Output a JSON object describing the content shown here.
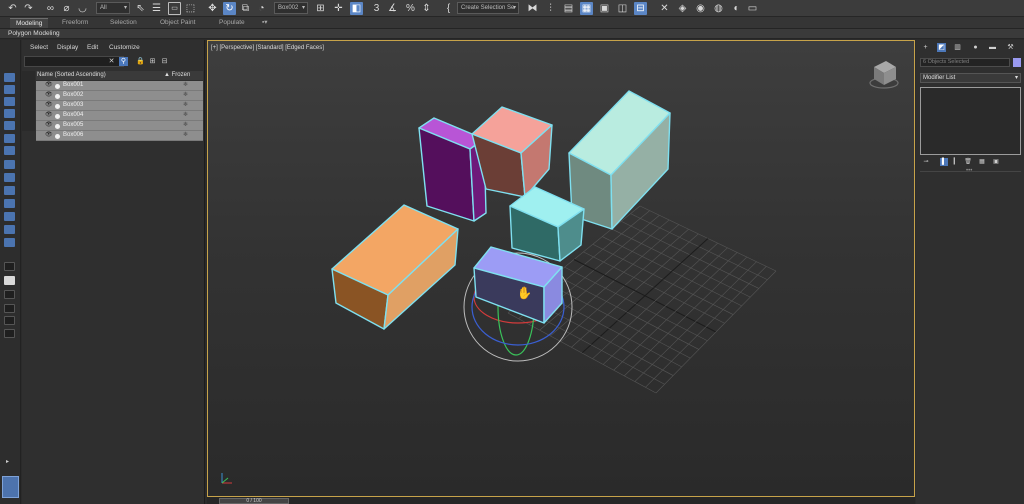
{
  "toolbar": {
    "selection_filter": "All",
    "named_selection": "Box002",
    "create_selection_set": "Create Selection Se",
    "icons": [
      "undo-icon",
      "redo-icon",
      "link-icon",
      "unlink-icon",
      "bind-space-warp-icon",
      "select-object-icon",
      "select-by-name-icon",
      "rect-region-icon",
      "window-crossing-icon",
      "move-icon",
      "rotate-icon",
      "scale-icon",
      "ref-coord-icon",
      "pivot-icon",
      "manipulate-icon",
      "snap-3d-icon",
      "angle-snap-icon",
      "percent-snap-icon",
      "spinner-snap-icon",
      "mirror-icon",
      "align-icon",
      "layers-icon",
      "scene-explorer-icon",
      "ribbon-icon",
      "curve-editor-icon",
      "schematic-icon",
      "material-editor-icon",
      "render-setup-icon",
      "render-frame-icon",
      "render-icon"
    ]
  },
  "ribbon": {
    "tabs": [
      "Modeling",
      "Freeform",
      "Selection",
      "Object Paint",
      "Populate"
    ],
    "active_tab": "Modeling",
    "sub_label": "Polygon Modeling"
  },
  "explorer": {
    "menu": [
      "Select",
      "Display",
      "Edit",
      "Customize"
    ],
    "header_name": "Name (Sorted Ascending)",
    "header_frozen": "▲ Frozen",
    "objects": [
      {
        "name": "Box001"
      },
      {
        "name": "Box002"
      },
      {
        "name": "Box003"
      },
      {
        "name": "Box004"
      },
      {
        "name": "Box005"
      },
      {
        "name": "Box006"
      }
    ]
  },
  "viewport": {
    "label": "[+] [Perspective] [Standard] [Edged Faces]",
    "selection_color": "#7fe0f0",
    "boxes": [
      {
        "name": "Box001",
        "top": "#f3a664",
        "left": "#8a5424",
        "right": "#e0a064"
      },
      {
        "name": "Box002",
        "top": "#9c9cf5",
        "left": "#3a3a5c",
        "right": "#8a8ae0"
      },
      {
        "name": "Box003",
        "top": "#f5a29a",
        "left": "#6b3e36",
        "right": "#c47870"
      },
      {
        "name": "Box004",
        "top": "#b855d6",
        "left": "#540f5c",
        "right": "#6e1a7a"
      },
      {
        "name": "Box005",
        "top": "#9ff0f0",
        "left": "#2f6a66",
        "right": "#4e8d8c"
      },
      {
        "name": "Box006",
        "top": "#b9ece0",
        "left": "#6f8a80",
        "right": "#95b0a5"
      }
    ]
  },
  "timeline": {
    "frame": "0 / 100"
  },
  "command_panel": {
    "name_placeholder": "6 Objects Selected",
    "modifier_list": "Modifier List",
    "color": "#9a9af0"
  }
}
